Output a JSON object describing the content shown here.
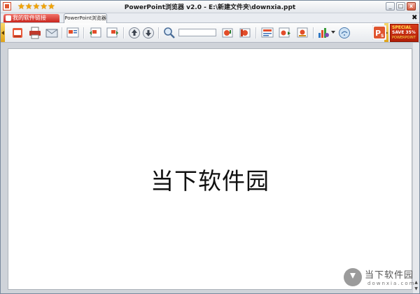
{
  "window": {
    "title": "PowerPoint浏览器 v2.0 - E:\\新建文件夹\\downxia.ppt",
    "rating_stars": "★★★★★"
  },
  "tabs": [
    {
      "label": "我的软件链接"
    },
    {
      "label": "PowerPoint浏览器"
    }
  ],
  "toolbar": {
    "icons": [
      "ppt-open-icon",
      "print-icon",
      "mail-icon",
      "slide-icon",
      "slide-prev-icon",
      "slide-next-icon",
      "arrow-up-icon",
      "arrow-down-icon",
      "zoom-icon",
      "zoom-in-icon",
      "zoom-out-icon",
      "view-icon",
      "play-icon",
      "settings-icon",
      "chart-icon",
      "help-icon"
    ],
    "zoom_value": ""
  },
  "promo": {
    "line1": "SPECIAL",
    "line2": "SAVE 35%",
    "line3": "POWERPOINT"
  },
  "slide": {
    "text": "当下软件园"
  },
  "watermark": {
    "name": "当下软件园",
    "url": "downxia.com"
  },
  "colors": {
    "accent": "#e0a318",
    "promo_red": "#c9251d"
  }
}
